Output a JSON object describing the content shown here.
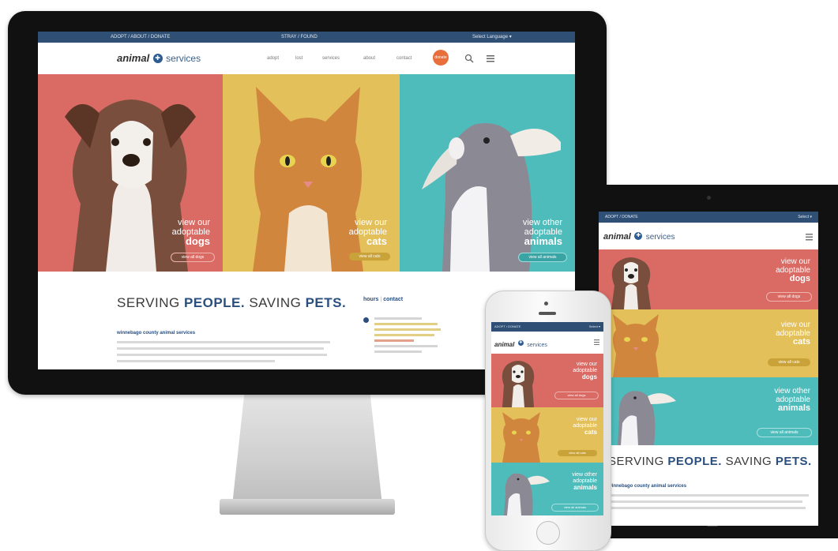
{
  "colors": {
    "navy": "#2f4f74",
    "coral": "#d96a64",
    "mustard": "#e3c05a",
    "teal": "#4fbcbc",
    "orange": "#e86f3c"
  },
  "desktop": {
    "topbar": {
      "left": "ADOPT / ABOUT / DONATE",
      "center": "STRAY / FOUND",
      "right": "Select Language ▾"
    },
    "logo": {
      "word1": "animal",
      "word2": "services"
    },
    "nav": [
      "adopt",
      "lost",
      "services",
      "about",
      "contact"
    ],
    "donate_label": "donate",
    "hero": [
      {
        "line1": "view our",
        "line2": "adoptable",
        "pet": "dogs",
        "button": "view all dogs"
      },
      {
        "line1": "view our",
        "line2": "adoptable",
        "pet": "cats",
        "button": "view all cats"
      },
      {
        "line1": "view other",
        "line2": "adoptable",
        "pet": "animals",
        "button": "view all animals"
      }
    ],
    "heading": {
      "part1": "SERVING ",
      "bold1": "PEOPLE.",
      "part2": " SAVING ",
      "bold2": "PETS."
    },
    "intro_org": "winnebago county animal services",
    "hours": {
      "title": "hours",
      "sep": "|",
      "subtitle": "contact"
    }
  },
  "tablet": {
    "topbar": {
      "left": "ADOPT / DONATE",
      "right": "Select ▾"
    },
    "logo": {
      "word1": "animal",
      "word2": "services"
    },
    "hero": [
      {
        "line1": "view our",
        "line2": "adoptable",
        "pet": "dogs",
        "button": "view all dogs"
      },
      {
        "line1": "view our",
        "line2": "adoptable",
        "pet": "cats",
        "button": "view all cats"
      },
      {
        "line1": "view other",
        "line2": "adoptable",
        "pet": "animals",
        "button": "view all animals"
      }
    ],
    "heading": {
      "part1": "SERVING ",
      "bold1": "PEOPLE.",
      "part2": " SAVING ",
      "bold2": "PETS."
    },
    "intro_org": "winnebago county animal services"
  },
  "phone": {
    "topbar": {
      "left": "ADOPT / DONATE",
      "right": "Select ▾"
    },
    "logo": {
      "word1": "animal",
      "word2": "services"
    },
    "hero": [
      {
        "line1": "view our",
        "line2": "adoptable",
        "pet": "dogs",
        "button": "view all dogs"
      },
      {
        "line1": "view our",
        "line2": "adoptable",
        "pet": "cats",
        "button": "view all cats"
      },
      {
        "line1": "view other",
        "line2": "adoptable",
        "pet": "animals",
        "button": "view all animals"
      }
    ]
  }
}
